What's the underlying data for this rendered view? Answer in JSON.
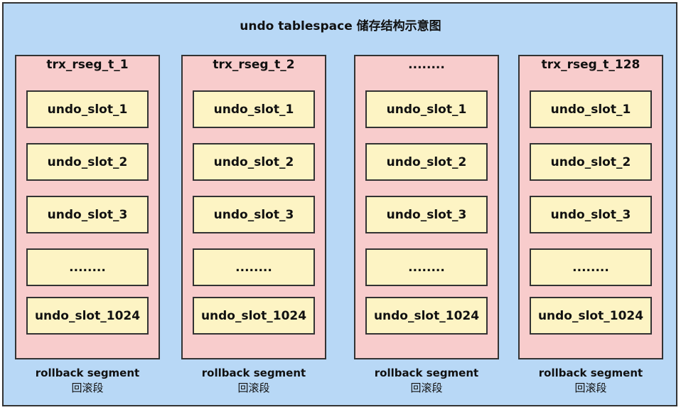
{
  "title": "undo tablespace 储存结构示意图",
  "segments": [
    {
      "name": "trx_rseg_t_1",
      "slots": [
        "undo_slot_1",
        "undo_slot_2",
        "undo_slot_3",
        "........",
        "undo_slot_1024"
      ],
      "caption_en": "rollback segment",
      "caption_cn": "回滚段"
    },
    {
      "name": "trx_rseg_t_2",
      "slots": [
        "undo_slot_1",
        "undo_slot_2",
        "undo_slot_3",
        "........",
        "undo_slot_1024"
      ],
      "caption_en": "rollback segment",
      "caption_cn": "回滚段"
    },
    {
      "name": "........",
      "slots": [
        "undo_slot_1",
        "undo_slot_2",
        "undo_slot_3",
        "........",
        "undo_slot_1024"
      ],
      "caption_en": "rollback segment",
      "caption_cn": "回滚段"
    },
    {
      "name": "trx_rseg_t_128",
      "slots": [
        "undo_slot_1",
        "undo_slot_2",
        "undo_slot_3",
        "........",
        "undo_slot_1024"
      ],
      "caption_en": "rollback segment",
      "caption_cn": "回滚段"
    }
  ],
  "colors": {
    "background": "#b8d8f6",
    "segment": "#f8cccc",
    "slot": "#fdf4c4",
    "border": "#333333"
  }
}
